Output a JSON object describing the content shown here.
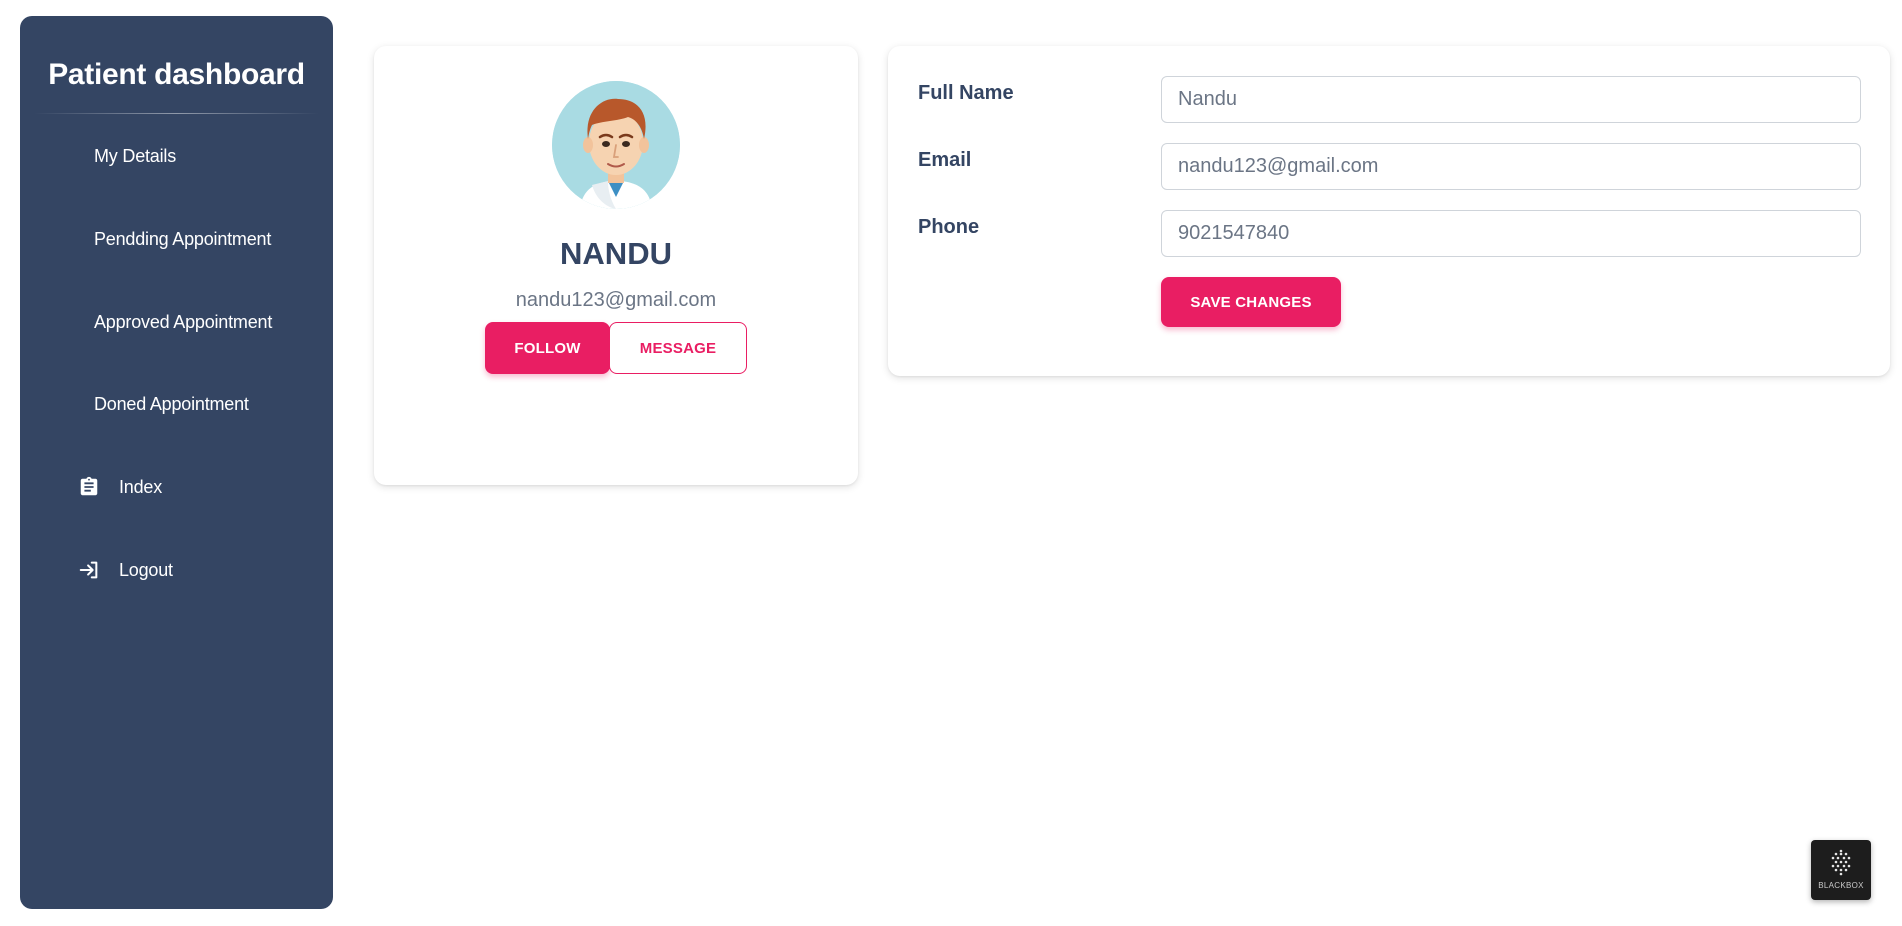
{
  "sidebar": {
    "title": "Patient dashboard",
    "items": [
      {
        "label": "My Details",
        "icon": null
      },
      {
        "label": "Pendding Appointment",
        "icon": null
      },
      {
        "label": "Approved Appointment",
        "icon": null
      },
      {
        "label": "Doned Appointment",
        "icon": null
      },
      {
        "label": "Index",
        "icon": "clipboard-icon"
      },
      {
        "label": "Logout",
        "icon": "logout-icon"
      }
    ]
  },
  "profile": {
    "name": "NANDU",
    "email": "nandu123@gmail.com",
    "follow_label": "FOLLOW",
    "message_label": "MESSAGE",
    "avatar_icon": "male-avatar-icon"
  },
  "form": {
    "full_name_label": "Full Name",
    "full_name_value": "Nandu",
    "email_label": "Email",
    "email_value": "nandu123@gmail.com",
    "phone_label": "Phone",
    "phone_value": "9021547840",
    "save_label": "SAVE CHANGES"
  },
  "badge": {
    "text": "BLACKBOX"
  },
  "colors": {
    "sidebar_bg": "#344563",
    "accent": "#e91e63",
    "heading": "#344563",
    "muted_text": "#6b7585"
  }
}
